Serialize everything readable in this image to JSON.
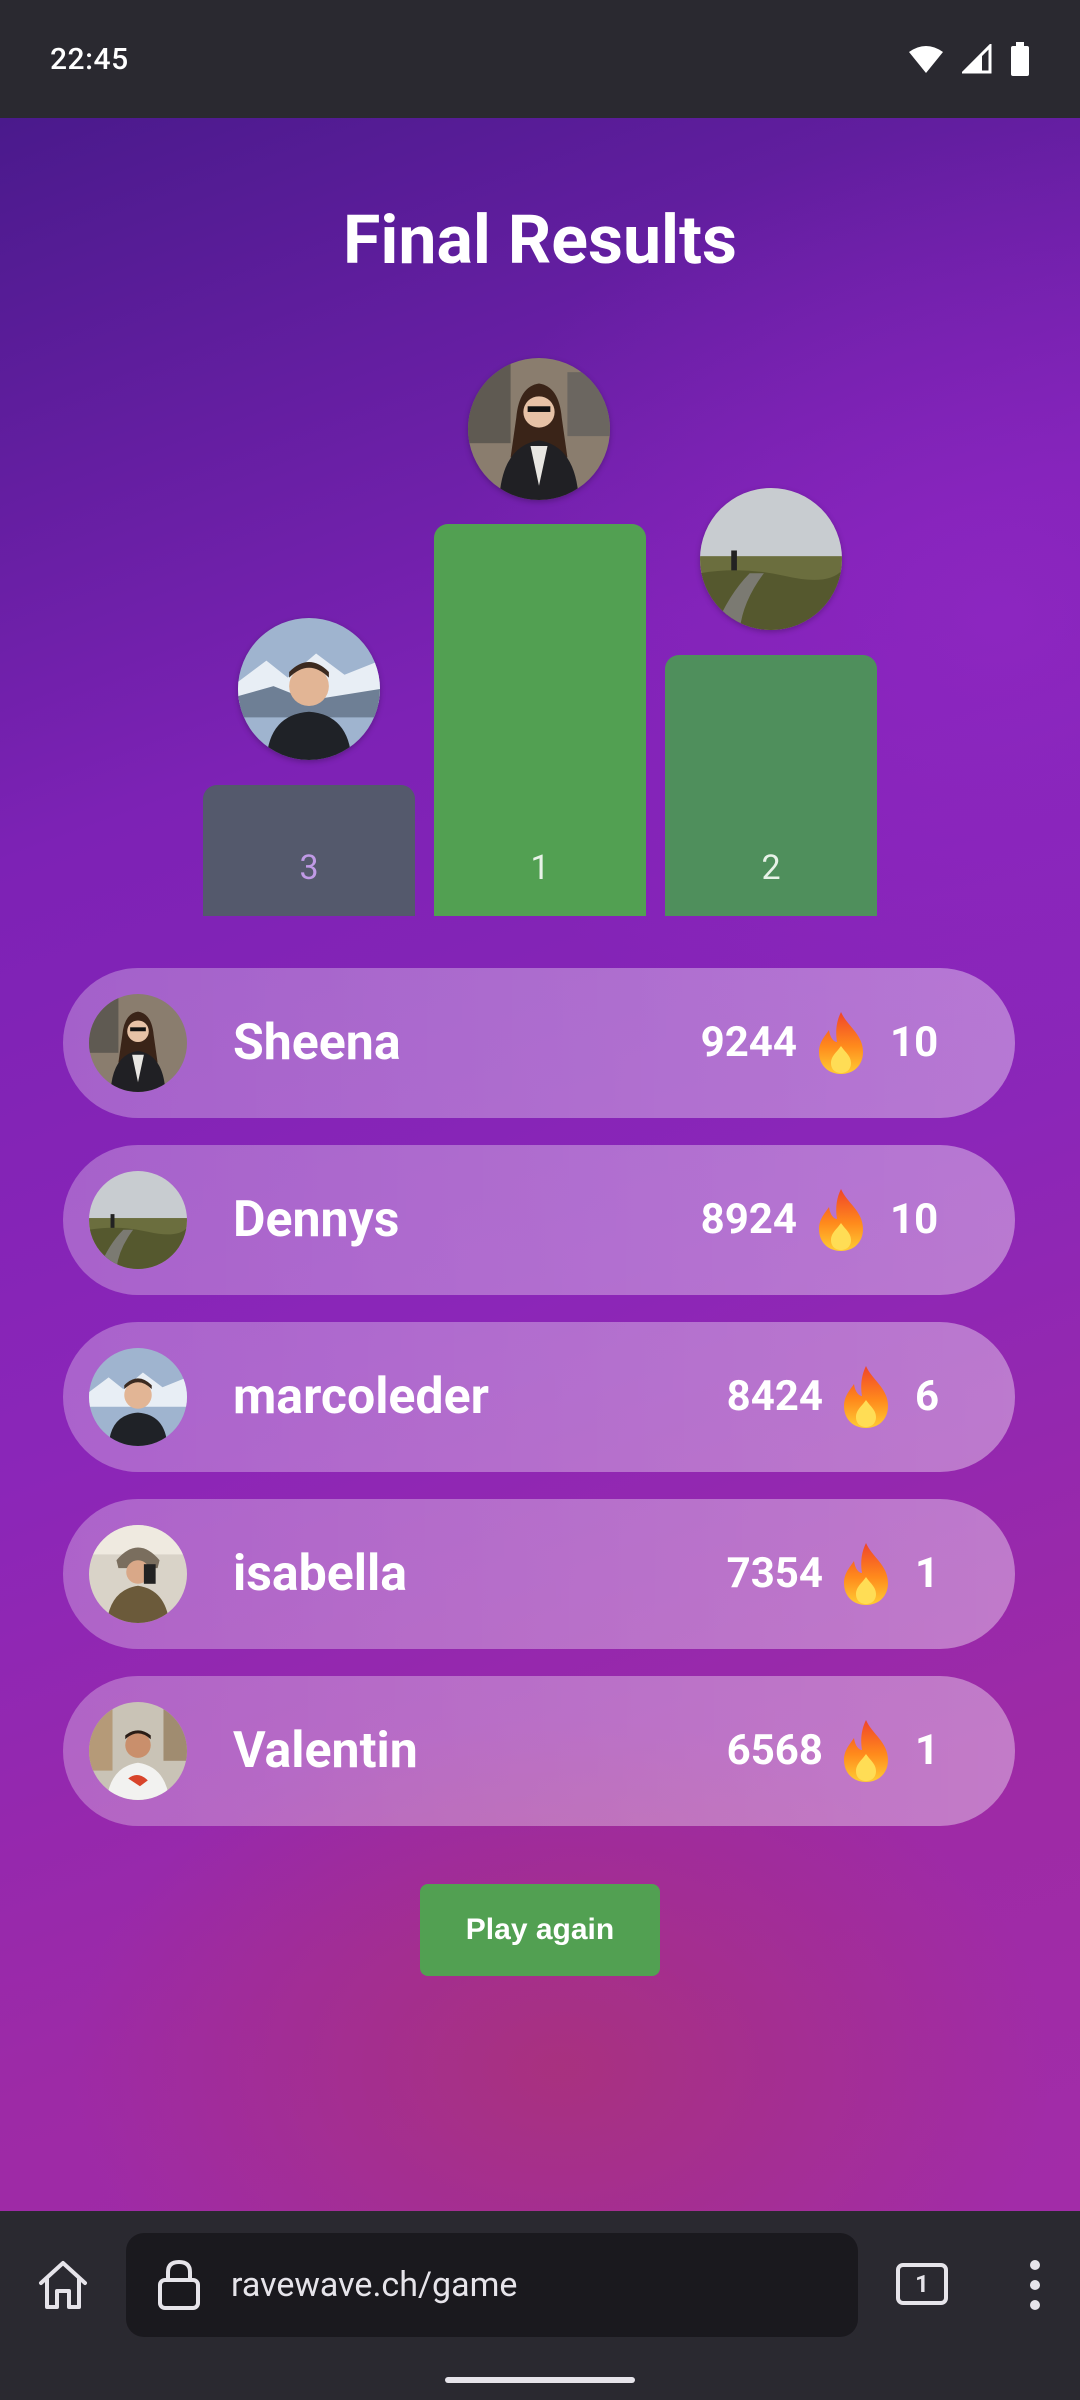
{
  "status_bar": {
    "time": "22:45"
  },
  "title": "Final Results",
  "podium": {
    "first": {
      "rank": "1",
      "color": "#52a052"
    },
    "second": {
      "rank": "2",
      "color": "#4f8f5c"
    },
    "third": {
      "rank": "3",
      "color": "#54596c"
    }
  },
  "leaderboard": [
    {
      "name": "Sheena",
      "score": "9244",
      "streak": "10"
    },
    {
      "name": "Dennys",
      "score": "8924",
      "streak": "10"
    },
    {
      "name": "marcoleder",
      "score": "8424",
      "streak": "6"
    },
    {
      "name": "isabella",
      "score": "7354",
      "streak": "1"
    },
    {
      "name": "Valentin",
      "score": "6568",
      "streak": "1"
    }
  ],
  "play_again_label": "Play again",
  "browser": {
    "url": "ravewave.ch/game",
    "tab_count": "1"
  }
}
